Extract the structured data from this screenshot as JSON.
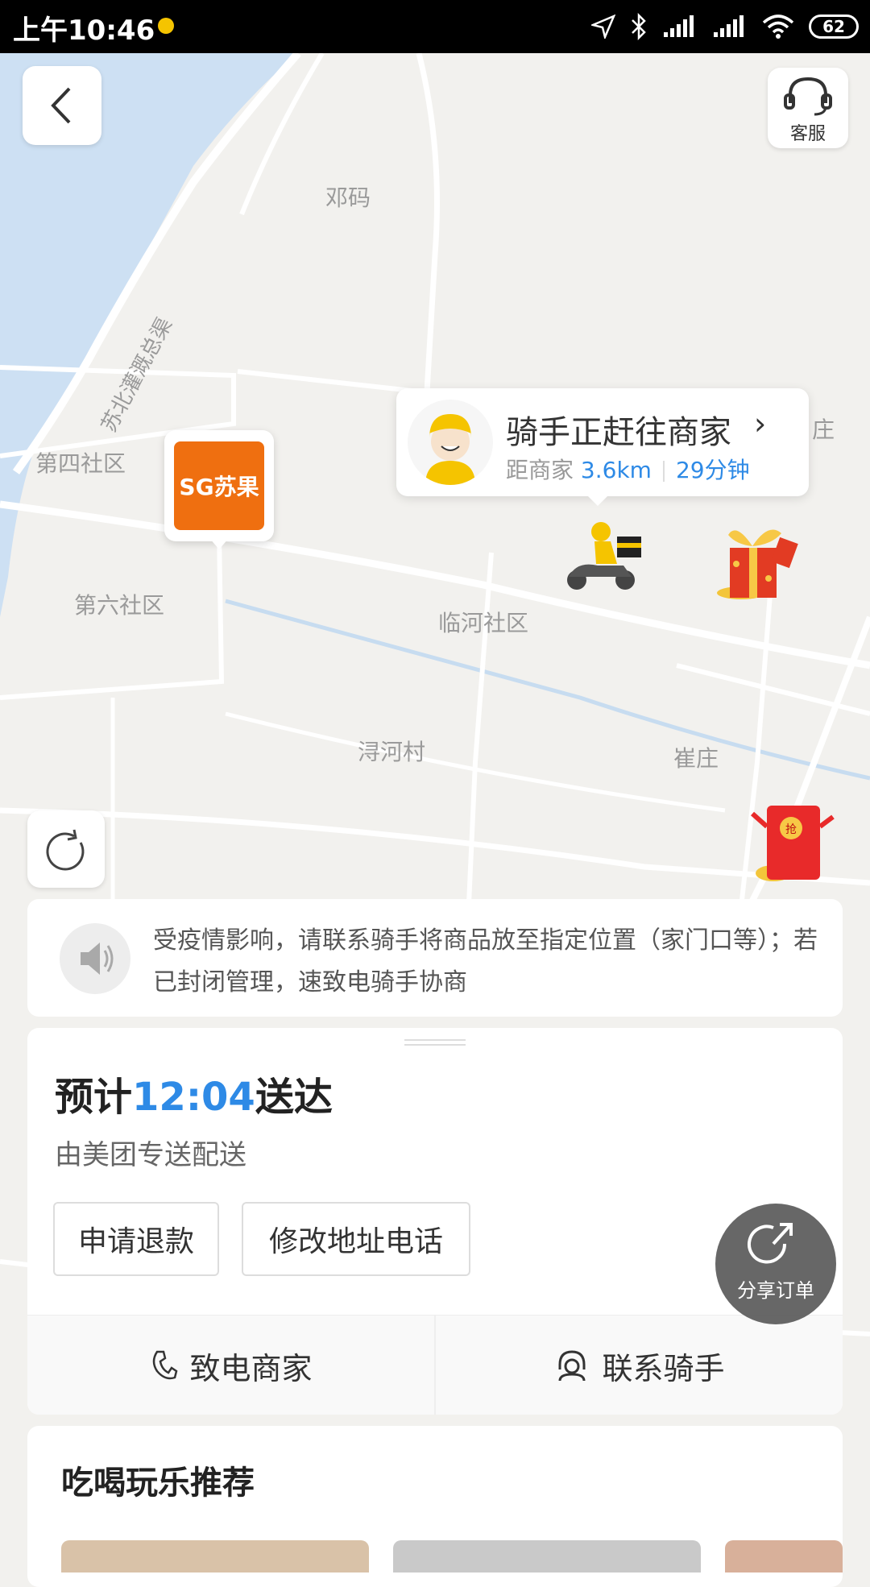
{
  "status_bar": {
    "time": "上午10:46",
    "battery": "62"
  },
  "map": {
    "labels": [
      "邓码",
      "苏北灌溉总渠",
      "第四社区",
      "第六社区",
      "临河社区",
      "浔河村",
      "崔庄",
      "庄"
    ]
  },
  "top_bar": {
    "service_label": "客服"
  },
  "merchant_pin": {
    "logo_text": "SG苏果"
  },
  "rider_card": {
    "title": "骑手正赶往商家",
    "distance_prefix": "距商家",
    "distance": "3.6km",
    "time": "29分钟"
  },
  "notice": {
    "text": "受疫情影响，请联系骑手将商品放至指定位置（家门口等）；若已封闭管理，速致电骑手协商"
  },
  "order_panel": {
    "eta_prefix": "预计",
    "eta_time": "12:04",
    "eta_suffix": "送达",
    "delivered_by": "由美团专送配送",
    "refund_button": "申请退款",
    "modify_button": "修改地址电话",
    "call_merchant": "致电商家",
    "contact_rider": "联系骑手"
  },
  "share_button": {
    "label": "分享订单"
  },
  "recommend": {
    "title": "吃喝玩乐推荐"
  },
  "colors": {
    "accent_blue": "#2e8ae6",
    "merchant_orange": "#ef6f10",
    "rider_yellow": "#f5c400"
  }
}
